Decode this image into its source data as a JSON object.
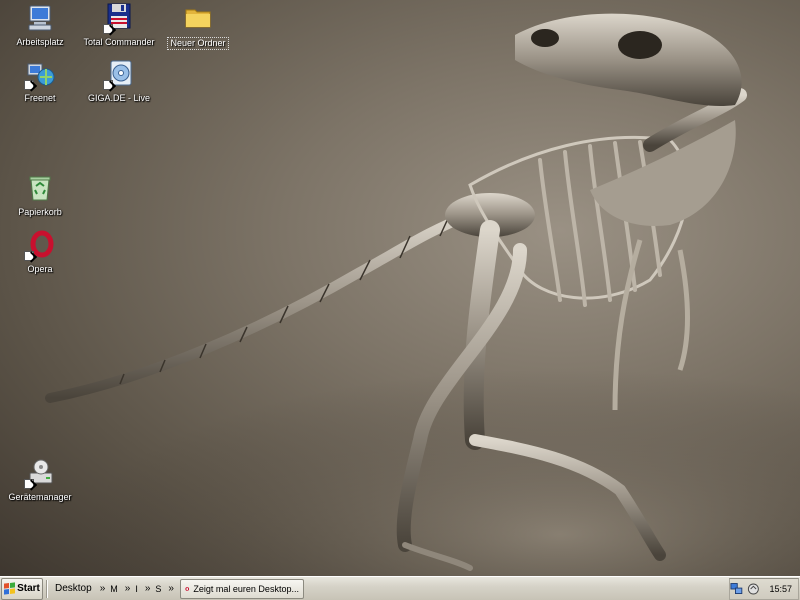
{
  "desktop": {
    "icons": [
      {
        "label": "Arbeitsplatz",
        "icon": "my-computer-icon",
        "shortcut": false
      },
      {
        "label": "Total Commander",
        "icon": "floppy-disk-icon",
        "shortcut": true
      },
      {
        "label": "Neuer Ordner",
        "icon": "folder-icon",
        "shortcut": false,
        "selected": true
      },
      {
        "label": "Freenet",
        "icon": "network-globe-icon",
        "shortcut": true
      },
      {
        "label": "GIGA.DE - Live",
        "icon": "media-cd-icon",
        "shortcut": true
      },
      {
        "label": "Papierkorb",
        "icon": "recycle-bin-icon",
        "shortcut": false
      },
      {
        "label": "Opera",
        "icon": "opera-icon",
        "shortcut": true
      },
      {
        "label": "Gerätemanager",
        "icon": "device-manager-icon",
        "shortcut": true
      }
    ]
  },
  "taskbar": {
    "start_label": "Start",
    "toolbar_label": "Desktop",
    "quick_items": [
      "M",
      "I",
      "S"
    ],
    "chevron": "»",
    "task_button_label": "Zeigt mal euren Desktop...",
    "clock": "15:57"
  },
  "colors": {
    "taskbar_bg": "#d6d3c8",
    "icon_label": "#ffffff",
    "folder_yellow": "#f4d35e",
    "opera_red": "#c8102e"
  }
}
